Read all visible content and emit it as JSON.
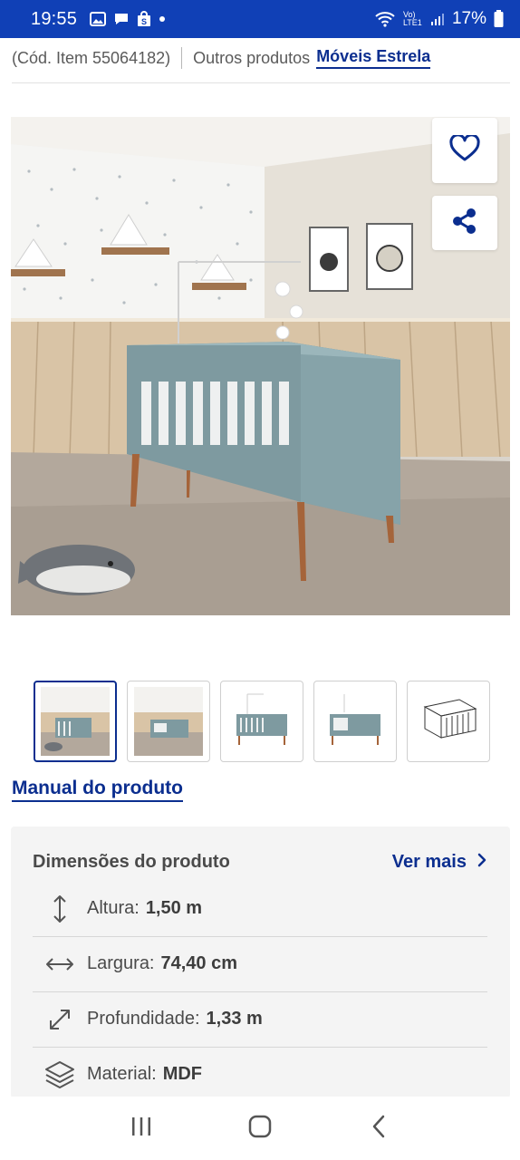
{
  "status_bar": {
    "time": "19:55",
    "network_label": "Vo) LTE1",
    "battery": "17%"
  },
  "header": {
    "item_code": "(Cód. Item 55064182)",
    "other_products_label": "Outros produtos",
    "brand_link": "Móveis Estrela"
  },
  "image_actions": {
    "favorite_icon": "heart-icon",
    "share_icon": "share-icon"
  },
  "thumbnails": {
    "count": 5,
    "active_index": 0
  },
  "manual_link": "Manual do produto",
  "dimensions": {
    "title": "Dimensões do produto",
    "see_more": "Ver mais",
    "rows": [
      {
        "icon": "vertical-arrows-icon",
        "label": "Altura:",
        "value": "1,50 m"
      },
      {
        "icon": "horizontal-arrows-icon",
        "label": "Largura:",
        "value": "74,40 cm"
      },
      {
        "icon": "diagonal-arrows-icon",
        "label": "Profundidade:",
        "value": "1,33 m"
      },
      {
        "icon": "layers-icon",
        "label": "Material:",
        "value": "MDF"
      }
    ]
  },
  "colors": {
    "status_bar": "#1040b6",
    "brand_blue": "#0b2e8f",
    "crib": "#7e9aa0"
  }
}
